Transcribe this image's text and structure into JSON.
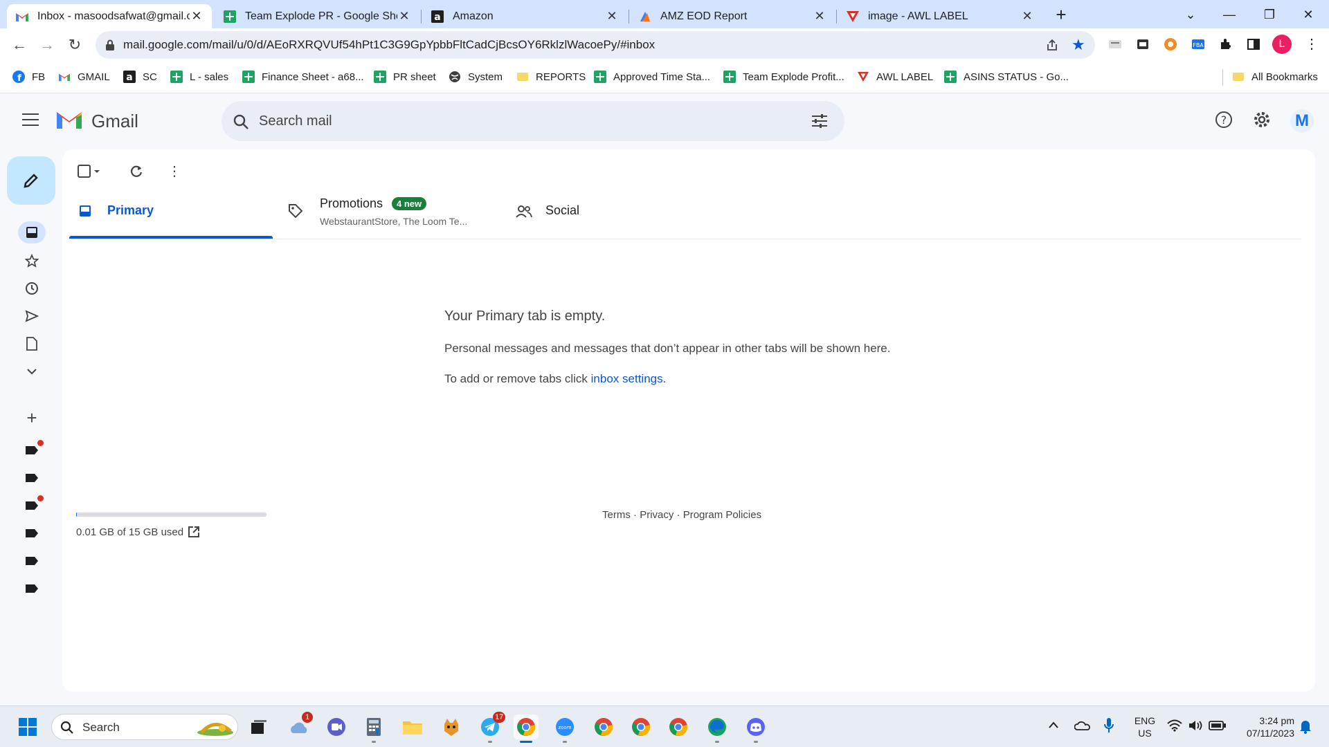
{
  "browser": {
    "tabs": [
      {
        "title": "Inbox - masoodsafwat@gmail.com - Gmail",
        "icon": "gmail-icon",
        "active": true
      },
      {
        "title": "Team Explode PR - Google Sheets",
        "icon": "sheets-icon",
        "active": false
      },
      {
        "title": "Amazon",
        "icon": "amazon-icon",
        "active": false
      },
      {
        "title": "AMZ EOD Report",
        "icon": "report-icon",
        "active": false
      },
      {
        "title": "image - AWL LABEL",
        "icon": "awl-icon",
        "active": false
      }
    ],
    "url": "mail.google.com/mail/u/0/d/AEoRXRQVUf54hPt1C3G9GpYpbbFltCadCjBcsOY6RklzlWacoePy/#inbox",
    "profile_initial": "L",
    "bookmarks": [
      {
        "label": "FB",
        "icon": "facebook-icon"
      },
      {
        "label": "GMAIL",
        "icon": "gmail-icon"
      },
      {
        "label": "SC",
        "icon": "amazon-icon"
      },
      {
        "label": "L - sales",
        "icon": "sheets-icon"
      },
      {
        "label": "Finance Sheet - a68...",
        "icon": "sheets-icon"
      },
      {
        "label": "PR sheet",
        "icon": "sheets-icon"
      },
      {
        "label": "System",
        "icon": "globe-icon"
      },
      {
        "label": "REPORTS",
        "icon": "folder-icon"
      },
      {
        "label": "Approved Time Sta...",
        "icon": "sheets-icon"
      },
      {
        "label": "Team Explode Profit...",
        "icon": "sheets-icon"
      },
      {
        "label": "AWL LABEL",
        "icon": "awl-icon"
      },
      {
        "label": "ASINS STATUS - Go...",
        "icon": "sheets-icon"
      }
    ],
    "all_bookmarks": "All Bookmarks"
  },
  "gmail": {
    "brand": "Gmail",
    "search_placeholder": "Search mail",
    "avatar_initial": "M",
    "tabs": [
      {
        "label": "Primary",
        "icon": "inbox-icon"
      },
      {
        "label": "Promotions",
        "icon": "tag-icon",
        "badge": "4 new",
        "snippet": "WebstaurantStore, The Loom Te..."
      },
      {
        "label": "Social",
        "icon": "people-icon"
      }
    ],
    "empty": {
      "title": "Your Primary tab is empty.",
      "line1": "Personal messages and messages that don’t appear in other tabs will be shown here.",
      "line2_prefix": "To add or remove tabs click ",
      "line2_link": "inbox settings",
      "line2_suffix": "."
    },
    "storage": {
      "text": "0.01 GB of 15 GB used",
      "fraction": 0.0007
    },
    "footer": {
      "terms": "Terms",
      "privacy": "Privacy",
      "policies": "Program Policies",
      "sep": " · "
    }
  },
  "taskbar": {
    "search_label": "Search",
    "badges": {
      "weather": "1",
      "telegram": "17"
    },
    "lang": "ENG",
    "region": "US",
    "time": "3:24 pm",
    "date": "07/11/2023"
  },
  "colors": {
    "gmail_blue": "#0b57d0",
    "badge_green": "#188038",
    "compose_bg": "#c2e7ff"
  }
}
